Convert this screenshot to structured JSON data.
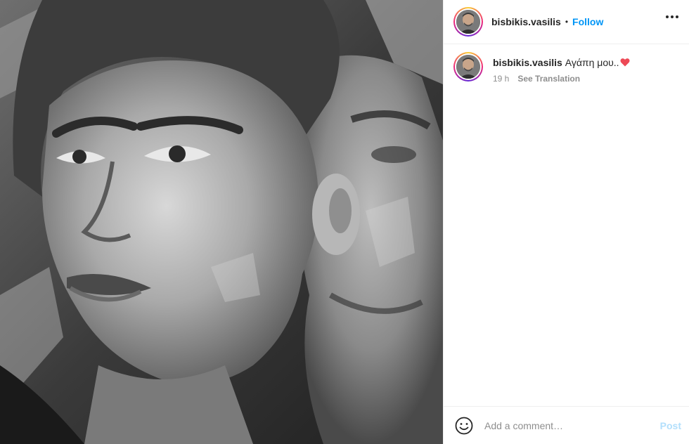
{
  "post": {
    "author": {
      "username": "bisbikis.vasilis",
      "avatar_icon": "profile-photo"
    },
    "header": {
      "separator": "•",
      "follow_label": "Follow",
      "more_icon": "ellipsis-icon"
    },
    "caption": {
      "username": "bisbikis.vasilis",
      "text": "Αγάπη μου..",
      "emoji": "red-heart",
      "time": "19 h",
      "see_translation": "See Translation"
    },
    "comment": {
      "emoji_icon": "smiley-icon",
      "placeholder": "Add a comment…",
      "post_label": "Post"
    },
    "colors": {
      "accent": "#0095f6",
      "post_disabled": "#b2dffc",
      "text": "#262626",
      "muted": "#8e8e8e",
      "border": "#efefef",
      "heart": "#ed4956"
    },
    "media": {
      "description_icon": "painted-portrait-artwork"
    }
  }
}
